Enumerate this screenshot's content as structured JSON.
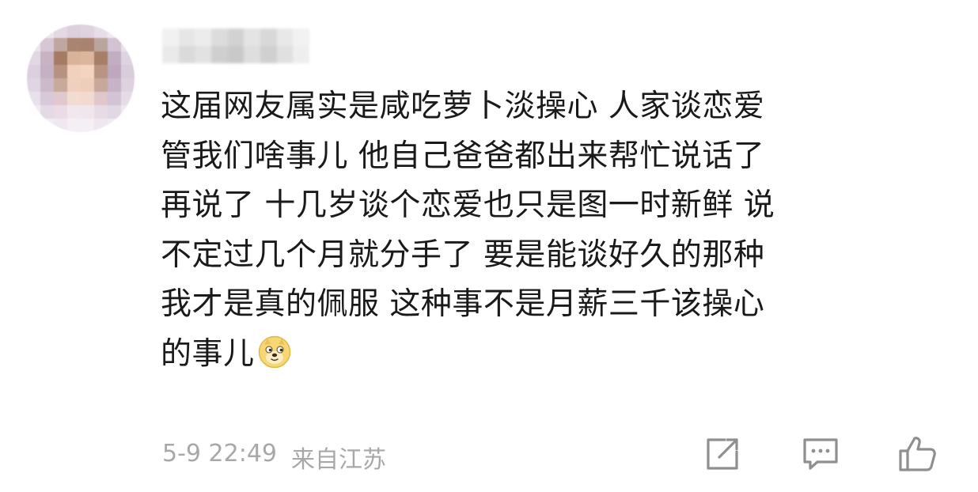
{
  "comment": {
    "author_avatar": "blurred-avatar",
    "author_name_blurred": true,
    "text_lines": [
      "这届网友属实是咸吃萝卜淡操心  人家谈恋爱",
      "管我们啥事儿  他自己爸爸都出来帮忙说话了",
      "再说了  十几岁谈个恋爱也只是图一时新鲜  说",
      "不定过几个月就分手了  要是能谈好久的那种",
      "我才是真的佩服  这种事不是月薪三千该操心",
      "的事儿"
    ],
    "trailing_emoji": "doge-emoji"
  },
  "meta": {
    "timestamp": "5-9 22:49",
    "location": "来自江苏"
  },
  "actions": {
    "share_icon": "share-icon",
    "comment_icon": "comment-icon",
    "like_icon": "thumbs-up-icon"
  },
  "colors": {
    "text": "#1a1a1a",
    "meta": "#a8a8a8",
    "icon": "#8f8f8f"
  }
}
